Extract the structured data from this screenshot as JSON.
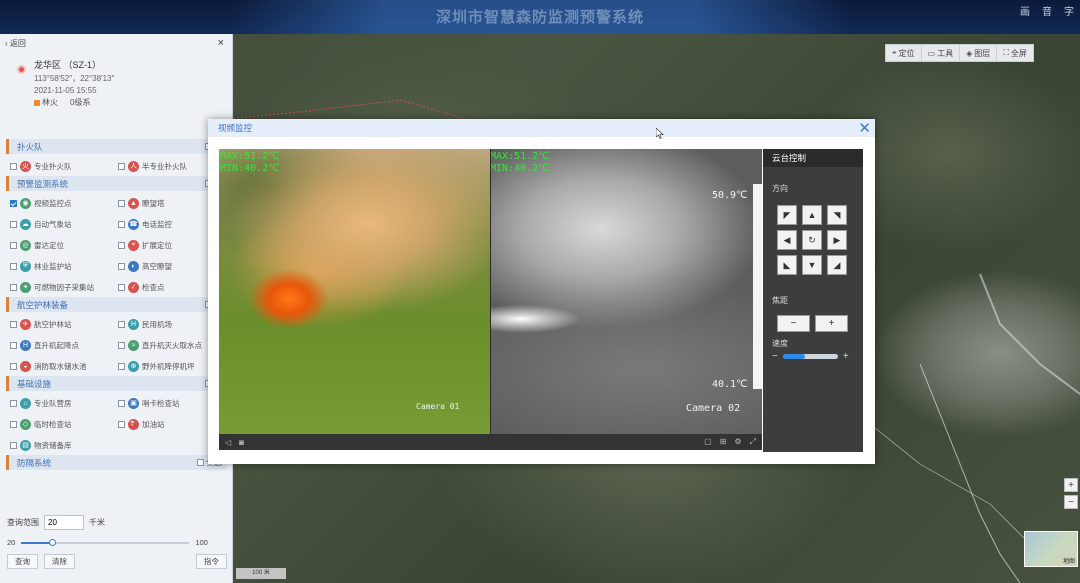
{
  "header": {
    "title": "深圳市智慧森防监测预警系统",
    "tools": [
      "画",
      "音",
      "字"
    ]
  },
  "panel": {
    "back_label": "返回",
    "close_label": "×",
    "location": {
      "name": "龙华区 （SZ-1）",
      "coords": "113°58′52″，22°38′13″",
      "time": "2021-11-05 15:55",
      "status_fire": "林火",
      "status_level": "0级系"
    },
    "sections": [
      {
        "title": "扑火队",
        "check_label": "全",
        "items": [
          {
            "label": "专业扑火队",
            "icon": "fire-team-icon",
            "checked": false
          },
          {
            "label": "半专业扑火队",
            "icon": "half-team-icon",
            "checked": false
          }
        ]
      },
      {
        "title": "预警监测系统",
        "check_label": "全",
        "items": [
          {
            "label": "视频监控点",
            "icon": "camera-icon",
            "checked": true
          },
          {
            "label": "瞭望塔",
            "icon": "tower-icon",
            "checked": false
          },
          {
            "label": "自动气象站",
            "icon": "weather-icon",
            "checked": false
          },
          {
            "label": "电话监控",
            "icon": "phone-icon",
            "checked": false
          },
          {
            "label": "雷达定位",
            "icon": "radar-icon",
            "checked": false
          },
          {
            "label": "扩展定位",
            "icon": "locate-icon",
            "checked": false
          },
          {
            "label": "林业监护站",
            "icon": "guard-icon",
            "checked": false
          },
          {
            "label": "高空瞭望",
            "icon": "binocular-icon",
            "checked": false
          },
          {
            "label": "可燃物因子采集站",
            "icon": "sensor-icon",
            "checked": false
          },
          {
            "label": "检查点",
            "icon": "checkpoint-icon",
            "checked": false
          }
        ]
      },
      {
        "title": "航空护林装备",
        "check_label": "全",
        "items": [
          {
            "label": "航空护林站",
            "icon": "plane-icon",
            "checked": false
          },
          {
            "label": "民用机场",
            "icon": "airport-icon",
            "checked": false
          },
          {
            "label": "直升机起降点",
            "icon": "heli-pad-icon",
            "checked": false
          },
          {
            "label": "直升机灭火取水点",
            "icon": "water-point-icon",
            "checked": false
          },
          {
            "label": "消防取水储水池",
            "icon": "water-tank-icon",
            "checked": false
          },
          {
            "label": "野外机降停机坪",
            "icon": "landing-icon",
            "checked": false
          }
        ]
      },
      {
        "title": "基础设施",
        "check_label": "全",
        "items": [
          {
            "label": "专业队营房",
            "icon": "barracks-icon",
            "checked": false
          },
          {
            "label": "哨卡检查站",
            "icon": "post-icon",
            "checked": false
          },
          {
            "label": "临时检查站",
            "icon": "temp-station-icon",
            "checked": false
          },
          {
            "label": "加油站",
            "icon": "gas-icon",
            "checked": false
          },
          {
            "label": "物资储备库",
            "icon": "warehouse-icon",
            "checked": false
          }
        ]
      },
      {
        "title": "防隔系统",
        "check_label": "全选",
        "items": []
      }
    ],
    "range": {
      "label": "查询范围",
      "value": "20",
      "unit": "千米",
      "min": "20",
      "max": "100",
      "slider_fraction": 0.18
    },
    "buttons": {
      "query": "查询",
      "clear": "清除",
      "dispatch": "指令"
    }
  },
  "map_toolbar": [
    {
      "label": "定位",
      "icon": "locate-icon"
    },
    {
      "label": "工具",
      "icon": "toolbox-icon"
    },
    {
      "label": "图层",
      "icon": "layers-icon"
    },
    {
      "label": "全屏",
      "icon": "fullscreen-icon"
    }
  ],
  "map": {
    "minimap_label": "地图",
    "zoom_in": "+",
    "zoom_out": "−",
    "scale": "100 米"
  },
  "modal": {
    "title": "视频监控",
    "close": "✕",
    "cam1": {
      "max": "MAX:51.2℃",
      "min": "MIN:40.2℃",
      "name": "Camera 01"
    },
    "cam2": {
      "max": "MAX:51.2℃",
      "min": "MIN:40.2℃",
      "top_temp": "50.9℃",
      "bottom_temp": "40.1℃",
      "name": "Camera 02"
    },
    "ptz": {
      "title": "云台控制",
      "direction_label": "方向",
      "focus_label": "焦距",
      "speed_label": "速度",
      "focus_minus": "−",
      "focus_plus": "+",
      "speed_minus": "−",
      "speed_plus": "+",
      "speed_fraction": 0.4
    }
  },
  "colors": {
    "accent": "#3f7ad2",
    "section_bar": "#e0803a",
    "osd_green": "#37e53a"
  }
}
